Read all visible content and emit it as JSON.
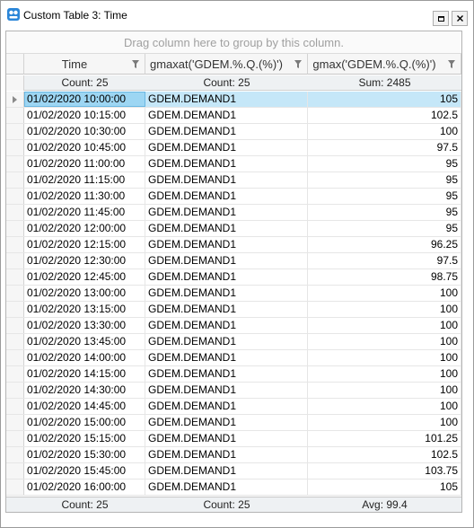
{
  "window": {
    "title": "Custom Table 3: Time"
  },
  "group_panel": {
    "hint": "Drag column here to group by this column."
  },
  "columns": [
    "Time",
    "gmaxat('GDEM.%.Q.(%)')",
    "gmax('GDEM.%.Q.(%)')"
  ],
  "top_summary": [
    "Count: 25",
    "Count: 25",
    "Sum: 2485"
  ],
  "bottom_summary": [
    "Count: 25",
    "Count: 25",
    "Avg: 99.4"
  ],
  "rows": [
    {
      "time": "01/02/2020 10:00:00",
      "gmaxat": "GDEM.DEMAND1",
      "gmax": "105"
    },
    {
      "time": "01/02/2020 10:15:00",
      "gmaxat": "GDEM.DEMAND1",
      "gmax": "102.5"
    },
    {
      "time": "01/02/2020 10:30:00",
      "gmaxat": "GDEM.DEMAND1",
      "gmax": "100"
    },
    {
      "time": "01/02/2020 10:45:00",
      "gmaxat": "GDEM.DEMAND1",
      "gmax": "97.5"
    },
    {
      "time": "01/02/2020 11:00:00",
      "gmaxat": "GDEM.DEMAND1",
      "gmax": "95"
    },
    {
      "time": "01/02/2020 11:15:00",
      "gmaxat": "GDEM.DEMAND1",
      "gmax": "95"
    },
    {
      "time": "01/02/2020 11:30:00",
      "gmaxat": "GDEM.DEMAND1",
      "gmax": "95"
    },
    {
      "time": "01/02/2020 11:45:00",
      "gmaxat": "GDEM.DEMAND1",
      "gmax": "95"
    },
    {
      "time": "01/02/2020 12:00:00",
      "gmaxat": "GDEM.DEMAND1",
      "gmax": "95"
    },
    {
      "time": "01/02/2020 12:15:00",
      "gmaxat": "GDEM.DEMAND1",
      "gmax": "96.25"
    },
    {
      "time": "01/02/2020 12:30:00",
      "gmaxat": "GDEM.DEMAND1",
      "gmax": "97.5"
    },
    {
      "time": "01/02/2020 12:45:00",
      "gmaxat": "GDEM.DEMAND1",
      "gmax": "98.75"
    },
    {
      "time": "01/02/2020 13:00:00",
      "gmaxat": "GDEM.DEMAND1",
      "gmax": "100"
    },
    {
      "time": "01/02/2020 13:15:00",
      "gmaxat": "GDEM.DEMAND1",
      "gmax": "100"
    },
    {
      "time": "01/02/2020 13:30:00",
      "gmaxat": "GDEM.DEMAND1",
      "gmax": "100"
    },
    {
      "time": "01/02/2020 13:45:00",
      "gmaxat": "GDEM.DEMAND1",
      "gmax": "100"
    },
    {
      "time": "01/02/2020 14:00:00",
      "gmaxat": "GDEM.DEMAND1",
      "gmax": "100"
    },
    {
      "time": "01/02/2020 14:15:00",
      "gmaxat": "GDEM.DEMAND1",
      "gmax": "100"
    },
    {
      "time": "01/02/2020 14:30:00",
      "gmaxat": "GDEM.DEMAND1",
      "gmax": "100"
    },
    {
      "time": "01/02/2020 14:45:00",
      "gmaxat": "GDEM.DEMAND1",
      "gmax": "100"
    },
    {
      "time": "01/02/2020 15:00:00",
      "gmaxat": "GDEM.DEMAND1",
      "gmax": "100"
    },
    {
      "time": "01/02/2020 15:15:00",
      "gmaxat": "GDEM.DEMAND1",
      "gmax": "101.25"
    },
    {
      "time": "01/02/2020 15:30:00",
      "gmaxat": "GDEM.DEMAND1",
      "gmax": "102.5"
    },
    {
      "time": "01/02/2020 15:45:00",
      "gmaxat": "GDEM.DEMAND1",
      "gmax": "103.75"
    },
    {
      "time": "01/02/2020 16:00:00",
      "gmaxat": "GDEM.DEMAND1",
      "gmax": "105"
    }
  ],
  "selected_row": 0,
  "colors": {
    "selection": "#c5e7f8",
    "selected_cell": "#9dd6f3",
    "header_bg": "#f6f6f6",
    "summary_bg": "#eef1f3"
  },
  "icons": [
    "app-icon",
    "restore-icon",
    "close-icon",
    "filter-icon",
    "row-indicator-arrow-icon"
  ]
}
